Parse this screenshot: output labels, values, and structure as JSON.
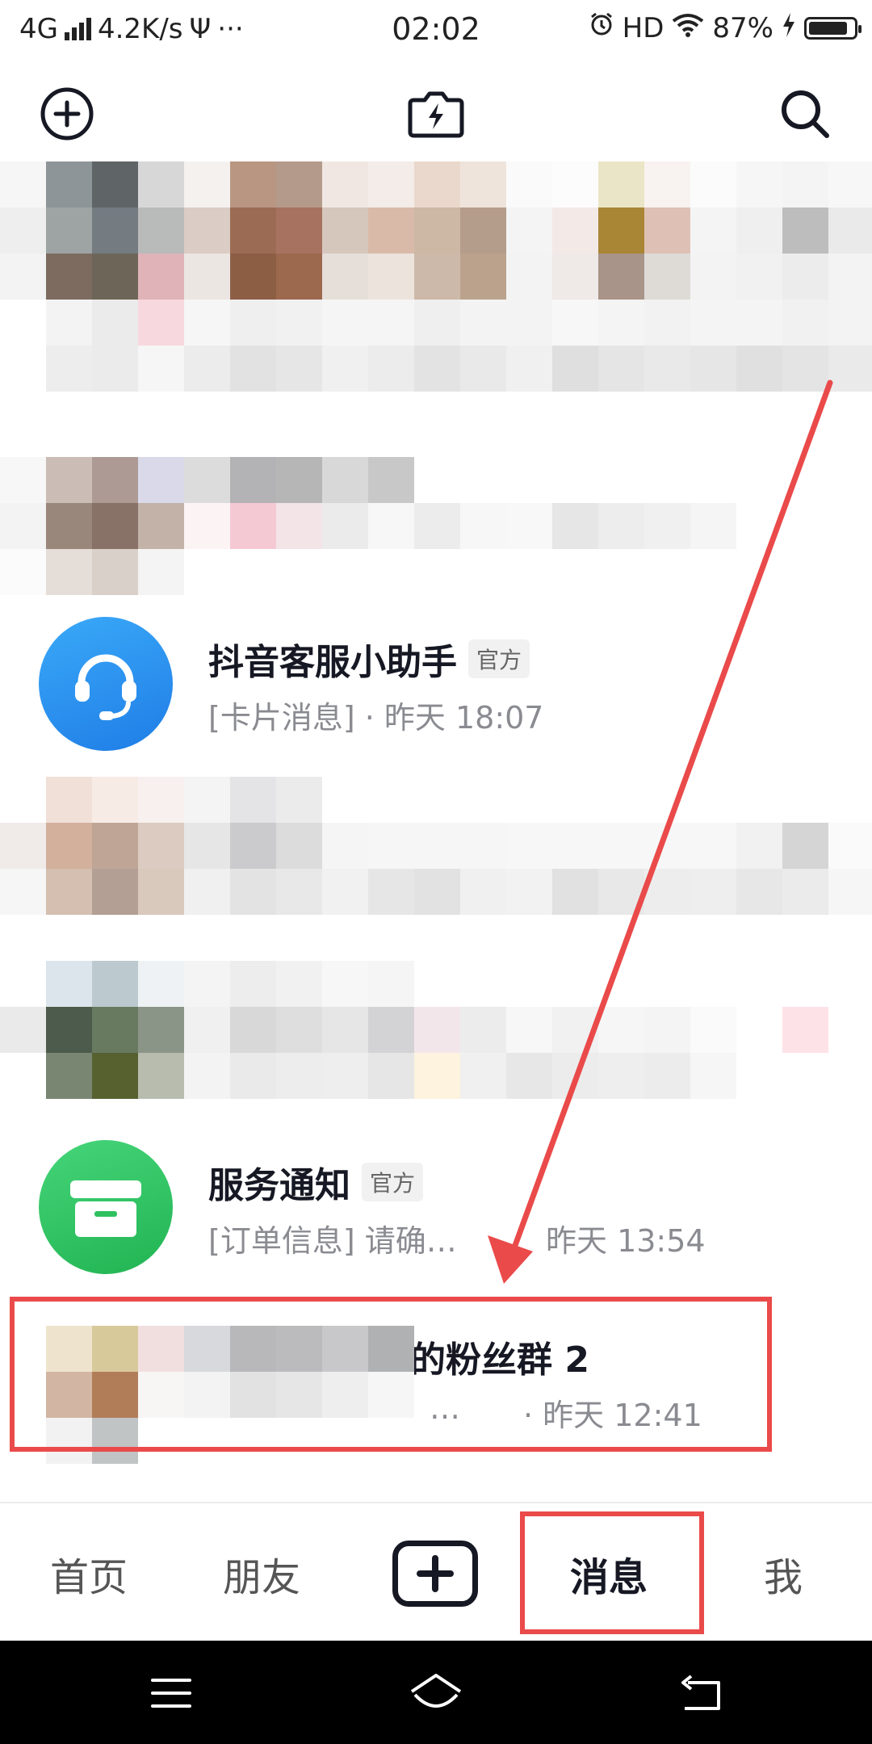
{
  "status_bar": {
    "network": "4G",
    "speed": "4.2K/s",
    "usb": "Ψ",
    "more": "···",
    "time": "02:02",
    "hd": "HD",
    "battery_percent": "87%",
    "battery_level": 0.87
  },
  "top_bar": {
    "add_icon": "plus-circle-icon",
    "center_icon": "lightning-camera-icon",
    "search_icon": "search-icon"
  },
  "messages": [
    {
      "name": "抖音客服小助手",
      "badge": "官方",
      "preview": "[卡片消息] · 昨天 18:07",
      "avatar_color": "#2f8ff0",
      "icon": "headset-icon"
    },
    {
      "name": "服务通知",
      "badge": "官方",
      "preview": "[订单信息] 请确…",
      "time": "昨天 13:54",
      "avatar_color": "#2fc15f",
      "icon": "inbox-icon"
    },
    {
      "name": "的粉丝群 2",
      "preview": "…",
      "time": "· 昨天 12:41"
    }
  ],
  "tab_bar": {
    "tabs": [
      "首页",
      "朋友",
      "消息",
      "我"
    ],
    "active_tab": "消息"
  },
  "colors": {
    "highlight": "#ea4a4a",
    "arrow": "#ea4a4a"
  }
}
